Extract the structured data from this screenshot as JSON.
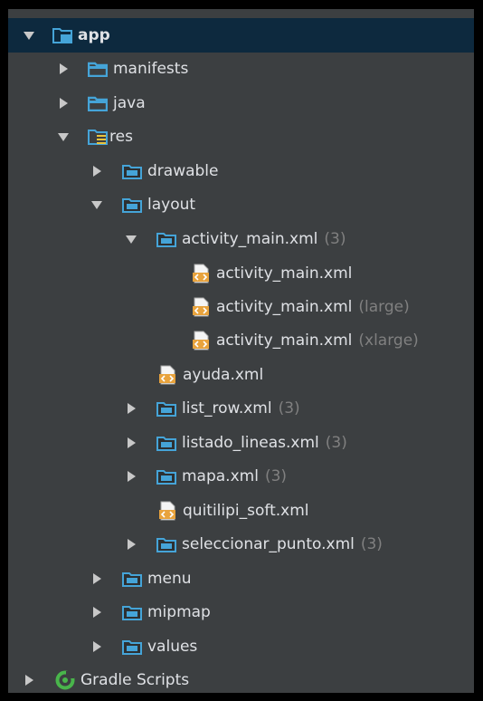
{
  "tree": {
    "app": {
      "label": "app"
    },
    "manifests": {
      "label": "manifests"
    },
    "java": {
      "label": "java"
    },
    "res": {
      "label": "res"
    },
    "drawable": {
      "label": "drawable"
    },
    "layout": {
      "label": "layout"
    },
    "activity_main_group": {
      "label": "activity_main.xml",
      "suffix": "(3)"
    },
    "activity_main_default": {
      "label": "activity_main.xml"
    },
    "activity_main_large": {
      "label": "activity_main.xml",
      "suffix": "(large)"
    },
    "activity_main_xlarge": {
      "label": "activity_main.xml",
      "suffix": "(xlarge)"
    },
    "ayuda": {
      "label": "ayuda.xml"
    },
    "list_row": {
      "label": "list_row.xml",
      "suffix": "(3)"
    },
    "listado_lineas": {
      "label": "listado_lineas.xml",
      "suffix": "(3)"
    },
    "mapa": {
      "label": "mapa.xml",
      "suffix": "(3)"
    },
    "quitilipi_soft": {
      "label": "quitilipi_soft.xml"
    },
    "seleccionar_punto": {
      "label": "seleccionar_punto.xml",
      "suffix": "(3)"
    },
    "menu": {
      "label": "menu"
    },
    "mipmap": {
      "label": "mipmap"
    },
    "values": {
      "label": "values"
    },
    "gradle_scripts": {
      "label": "Gradle Scripts"
    }
  },
  "colors": {
    "panel_bg": "#3c3f41",
    "selected_bg": "#0d293e",
    "text": "#dfe1e5",
    "suffix_text": "#808080",
    "folder_blue": "#45a4d8",
    "file_orange": "#e8a33d",
    "gradle_green": "#49b54b"
  },
  "icons": {
    "expanded": "triangle-down-icon",
    "collapsed": "triangle-right-icon",
    "module": "module-folder-icon",
    "source_folder": "source-folder-icon",
    "resource_root": "resource-folder-icon",
    "resource_folder": "resource-subfolder-icon",
    "xml_file": "xml-file-icon",
    "gradle": "gradle-icon"
  }
}
